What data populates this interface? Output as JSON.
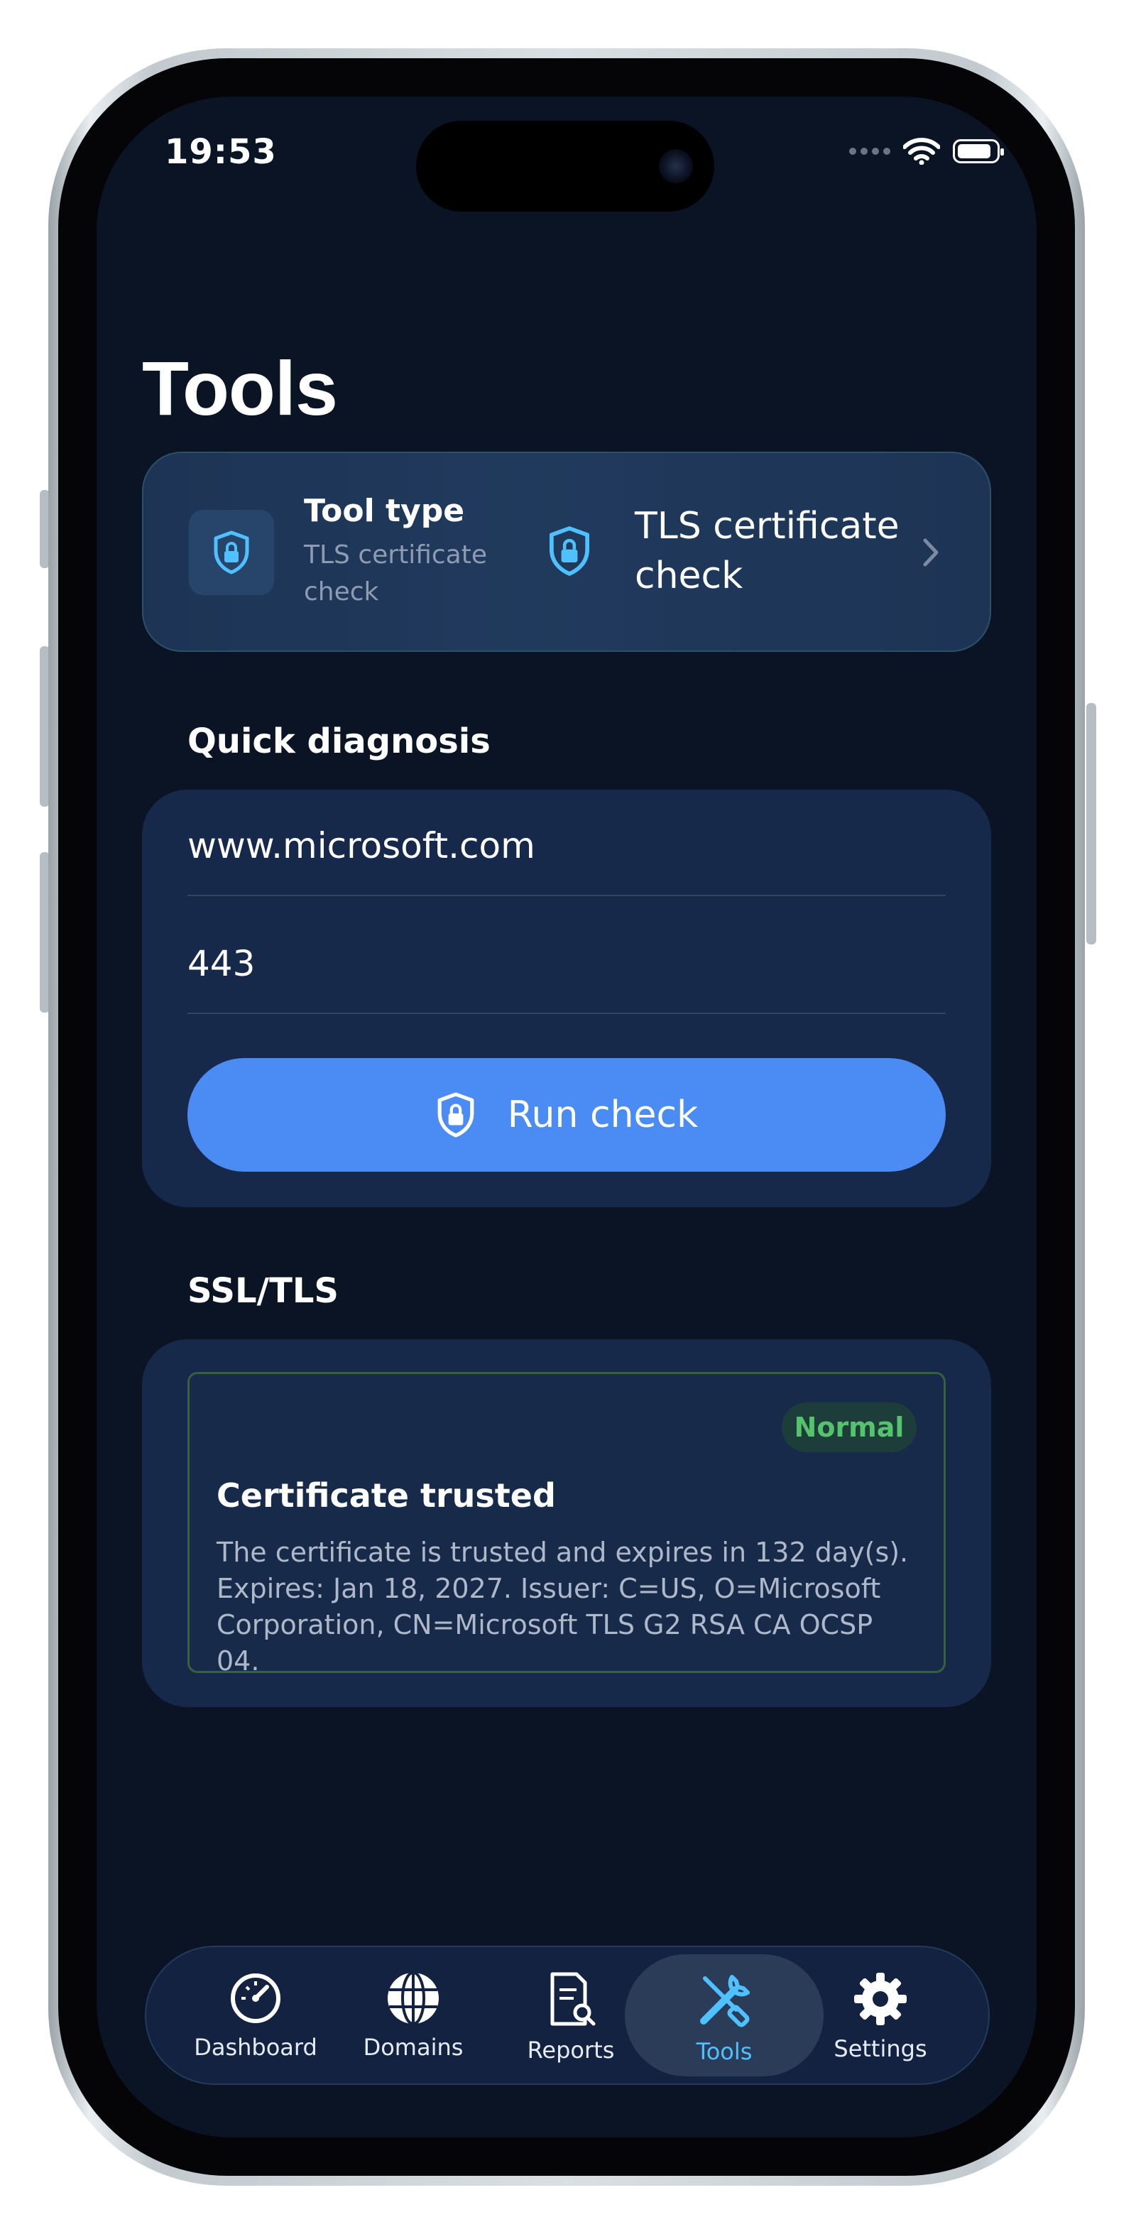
{
  "status_bar": {
    "time": "19:53"
  },
  "page": {
    "title": "Tools"
  },
  "tool_type": {
    "label": "Tool type",
    "subtitle": "TLS certificate check",
    "selected_value": "TLS certificate check"
  },
  "quick_diagnosis": {
    "section_title": "Quick diagnosis",
    "host_value": "www.microsoft.com",
    "port_value": "443",
    "run_button_label": "Run check"
  },
  "ssl_tls": {
    "section_title": "SSL/TLS",
    "badge": "Normal",
    "result_title": "Certificate trusted",
    "result_description": "The certificate is trusted and expires in 132 day(s). Expires: Jan 18, 2027. Issuer: C=US, O=Microsoft Corporation, CN=Microsoft TLS G2 RSA CA OCSP 04."
  },
  "tab_bar": {
    "items": [
      {
        "label": "Dashboard",
        "icon": "gauge-icon"
      },
      {
        "label": "Domains",
        "icon": "globe-icon"
      },
      {
        "label": "Reports",
        "icon": "document-search-icon"
      },
      {
        "label": "Tools",
        "icon": "wrench-screwdriver-icon",
        "active": true
      },
      {
        "label": "Settings",
        "icon": "gear-icon"
      }
    ]
  },
  "colors": {
    "background": "#0b1424",
    "card": "#17294a",
    "accent_button": "#4b8bf4",
    "accent_icon": "#4fc1ff",
    "status_normal": "#55c36c"
  }
}
